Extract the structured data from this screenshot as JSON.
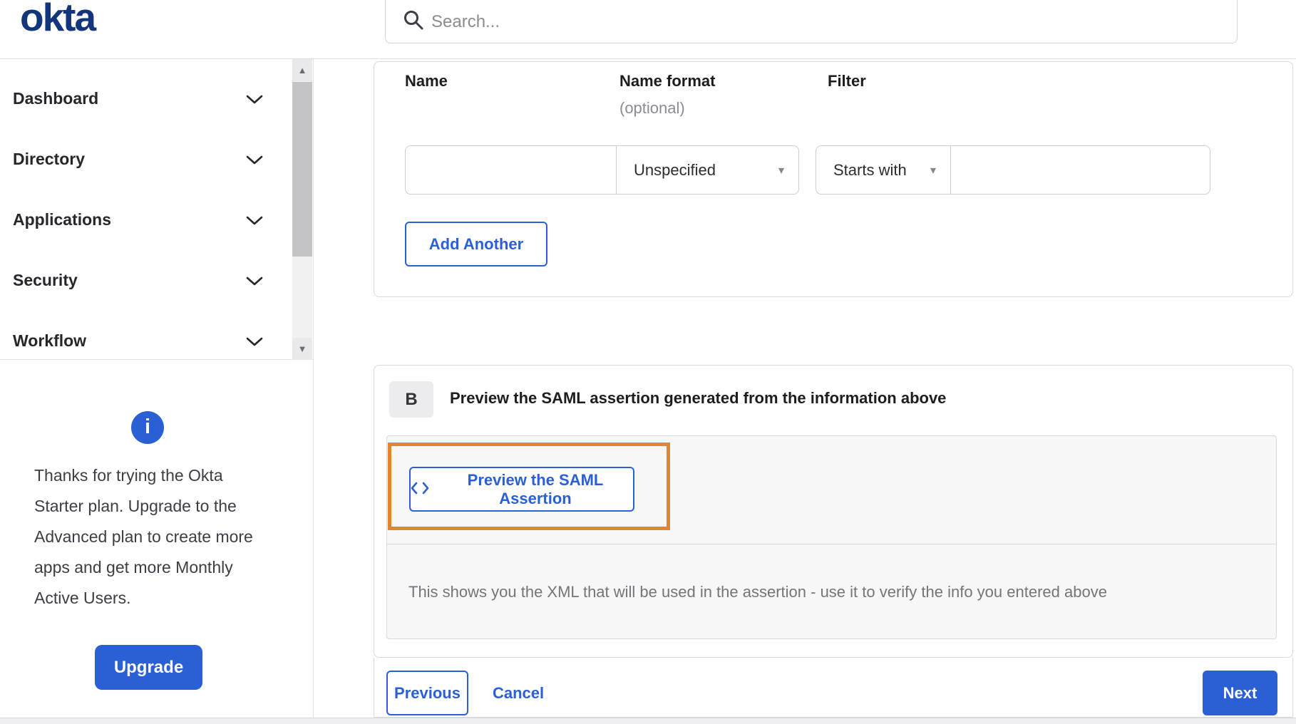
{
  "header": {
    "logo_text": "okta",
    "search": {
      "placeholder": "Search...",
      "value": ""
    }
  },
  "sidebar": {
    "items": [
      {
        "label": "Dashboard"
      },
      {
        "label": "Directory"
      },
      {
        "label": "Applications"
      },
      {
        "label": "Security"
      },
      {
        "label": "Workflow"
      }
    ],
    "trial_notice": "Thanks for trying the Okta Starter plan. Upgrade to the Advanced plan to create more apps and get more Monthly Active Users.",
    "upgrade_label": "Upgrade"
  },
  "attribute_form": {
    "name_label": "Name",
    "name_format_label": "Name format",
    "name_format_hint": "(optional)",
    "filter_label": "Filter",
    "name_value": "",
    "name_format_value": "Unspecified",
    "filter_type_value": "Starts with",
    "filter_value": "",
    "add_another_label": "Add Another"
  },
  "preview_section": {
    "step_badge": "B",
    "title": "Preview the SAML assertion generated from the information above",
    "preview_button_label": "Preview the SAML Assertion",
    "description": "This shows you the XML that will be used in the assertion - use it to verify the info you entered above"
  },
  "footer": {
    "previous_label": "Previous",
    "cancel_label": "Cancel",
    "next_label": "Next"
  },
  "icons": {
    "dropdown_caret": "▾",
    "scroll_up": "▲",
    "scroll_down": "▼",
    "info_glyph": "i"
  },
  "colors": {
    "brand_navy": "#12357c",
    "primary_blue": "#2b5fd6",
    "highlight_orange": "#e0872e",
    "panel_gray": "#f7f7f8"
  }
}
